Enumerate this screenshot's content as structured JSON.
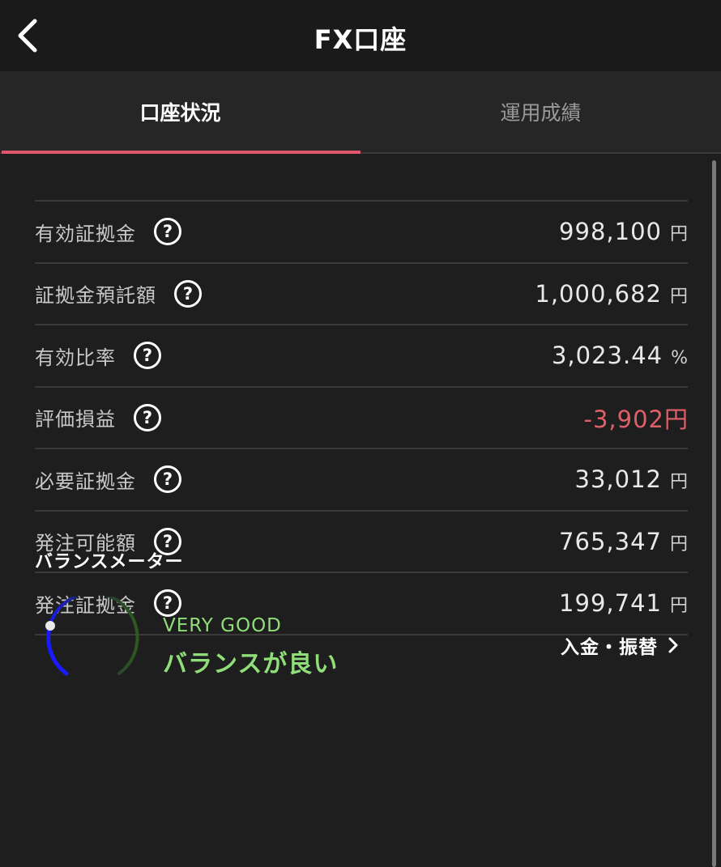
{
  "header": {
    "title": "FX口座",
    "back_icon": "chevron-left-icon"
  },
  "tabs": [
    {
      "label": "口座状況",
      "active": true
    },
    {
      "label": "運用成績",
      "active": false
    }
  ],
  "account_rows": [
    {
      "label": "有効証拠金",
      "value": "998,100",
      "unit": "円"
    },
    {
      "label": "証拠金預託額",
      "value": "1,000,682",
      "unit": "円"
    },
    {
      "label": "有効比率",
      "value": "3,023.44",
      "unit": "%"
    },
    {
      "label": "評価損益",
      "value": "-3,902",
      "unit": "円"
    },
    {
      "label": "必要証拠金",
      "value": "33,012",
      "unit": "円"
    },
    {
      "label": "発注可能額",
      "value": "765,347",
      "unit": "円"
    },
    {
      "label": "発注証拠金",
      "value": "199,741",
      "unit": "円"
    }
  ],
  "help_icon": "?",
  "balance_meter": {
    "heading": "バランスメーター",
    "status_en": "VERY GOOD",
    "status_jp": "バランスが良い"
  },
  "transfer_link": {
    "label": "入金・振替"
  },
  "colors": {
    "accent_tab": "#e0566b",
    "negative": "#e0606a",
    "good": "#8fde7a",
    "gauge_blue": "#1a1aff",
    "gauge_green": "#2f5a1e"
  }
}
